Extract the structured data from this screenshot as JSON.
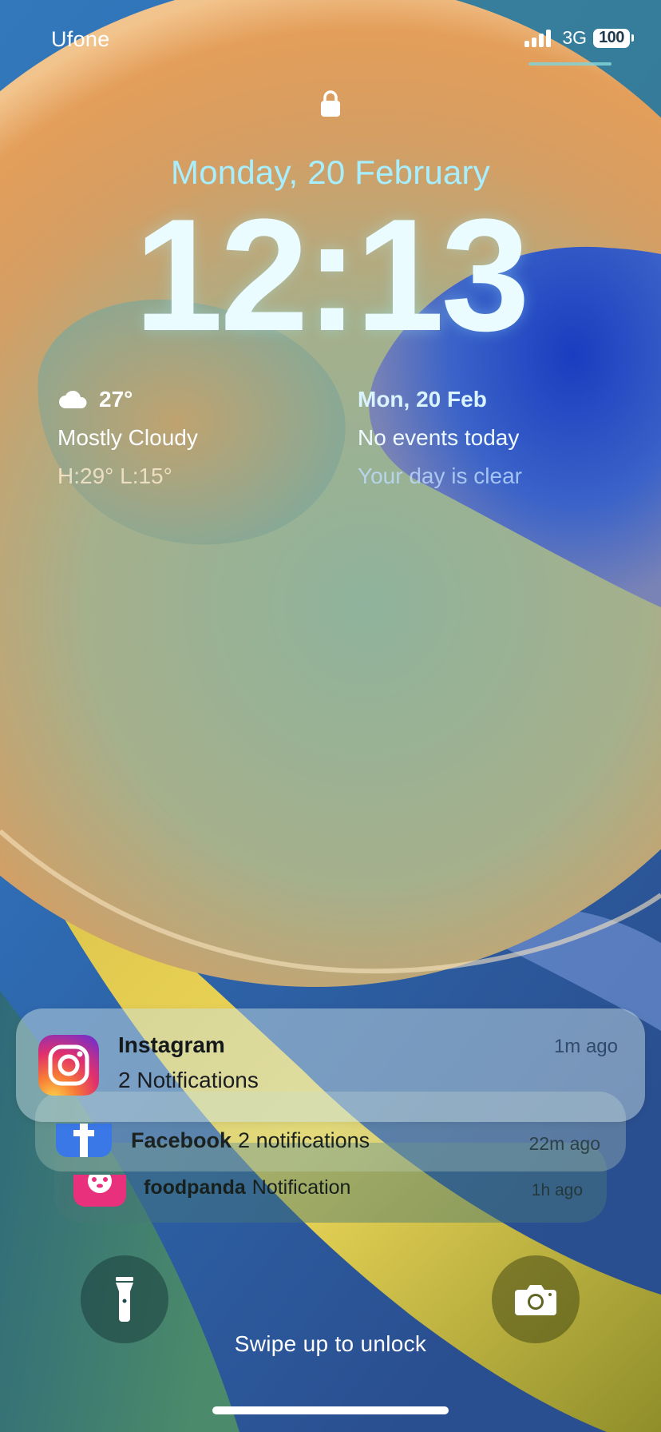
{
  "status_bar": {
    "carrier": "Ufone",
    "network": "3G",
    "battery": "100",
    "signal_icon": "cellular-signal-icon"
  },
  "lock": {
    "icon": "lock-icon"
  },
  "clock": {
    "date": "Monday, 20 February",
    "time": "12:13"
  },
  "weather_widget": {
    "icon": "cloud-icon",
    "temperature": "27°",
    "condition": "Mostly Cloudy",
    "high_low": "H:29° L:15°"
  },
  "calendar_widget": {
    "date": "Mon, 20 Feb",
    "events": "No events today",
    "subtitle": "Your day is clear"
  },
  "notifications": [
    {
      "app": "Instagram",
      "body": "2 Notifications",
      "time": "1m ago",
      "icon": "instagram-icon"
    },
    {
      "app": "Facebook",
      "body": "2 notifications",
      "time": "22m ago",
      "icon": "facebook-icon"
    },
    {
      "app": "foodpanda",
      "body": "Notification",
      "time": "1h ago",
      "icon": "foodpanda-icon"
    }
  ],
  "controls": {
    "flashlight_icon": "flashlight-icon",
    "camera_icon": "camera-icon",
    "swipe_text": "Swipe up to unlock"
  },
  "colors": {
    "date_text": "#a7efff",
    "time_text": "#eafcff",
    "instagram_gradient": [
      "#f9ce34",
      "#ee2a7b",
      "#6228d7"
    ],
    "facebook_blue": "#1877f2",
    "foodpanda_pink": "#e8307c"
  }
}
